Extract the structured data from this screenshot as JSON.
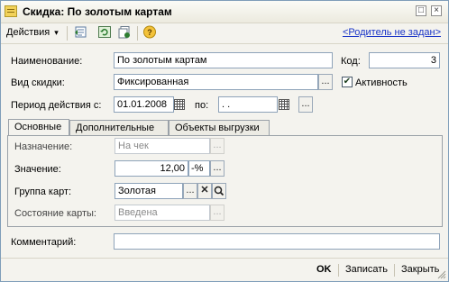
{
  "window": {
    "title": "Скидка: По золотым картам",
    "buttons": {
      "restore": "□",
      "close": "×"
    }
  },
  "toolbar": {
    "actions_label": "Действия",
    "actions_arrow": "▾",
    "parent_link": "<Родитель не задан>"
  },
  "form": {
    "name_label": "Наименование:",
    "name_value": "По золотым картам",
    "code_label": "Код:",
    "code_value": "3",
    "type_label": "Вид скидки:",
    "type_value": "Фиксированная",
    "active_label": "Активность",
    "active_checked": true,
    "period_label": "Период действия с:",
    "period_from": "01.01.2008",
    "period_to_label": "по:",
    "period_to": " .  .",
    "select_button": "..."
  },
  "tabs": [
    {
      "label": "Основные",
      "active": true
    },
    {
      "label": "Дополнительные",
      "active": false
    },
    {
      "label": "Объекты выгрузки",
      "active": false
    }
  ],
  "main_tab": {
    "purpose_label": "Назначение:",
    "purpose_value": "На чек",
    "value_label": "Значение:",
    "value_value": "12,00",
    "value_unit": "-%",
    "card_group_label": "Группа карт:",
    "card_group_value": "Золотая",
    "card_state_label": "Состояние карты:",
    "card_state_value": "Введена"
  },
  "comment_label": "Комментарий:",
  "comment_value": "",
  "bottom": {
    "ok": "OK",
    "save": "Записать",
    "close": "Закрыть"
  }
}
